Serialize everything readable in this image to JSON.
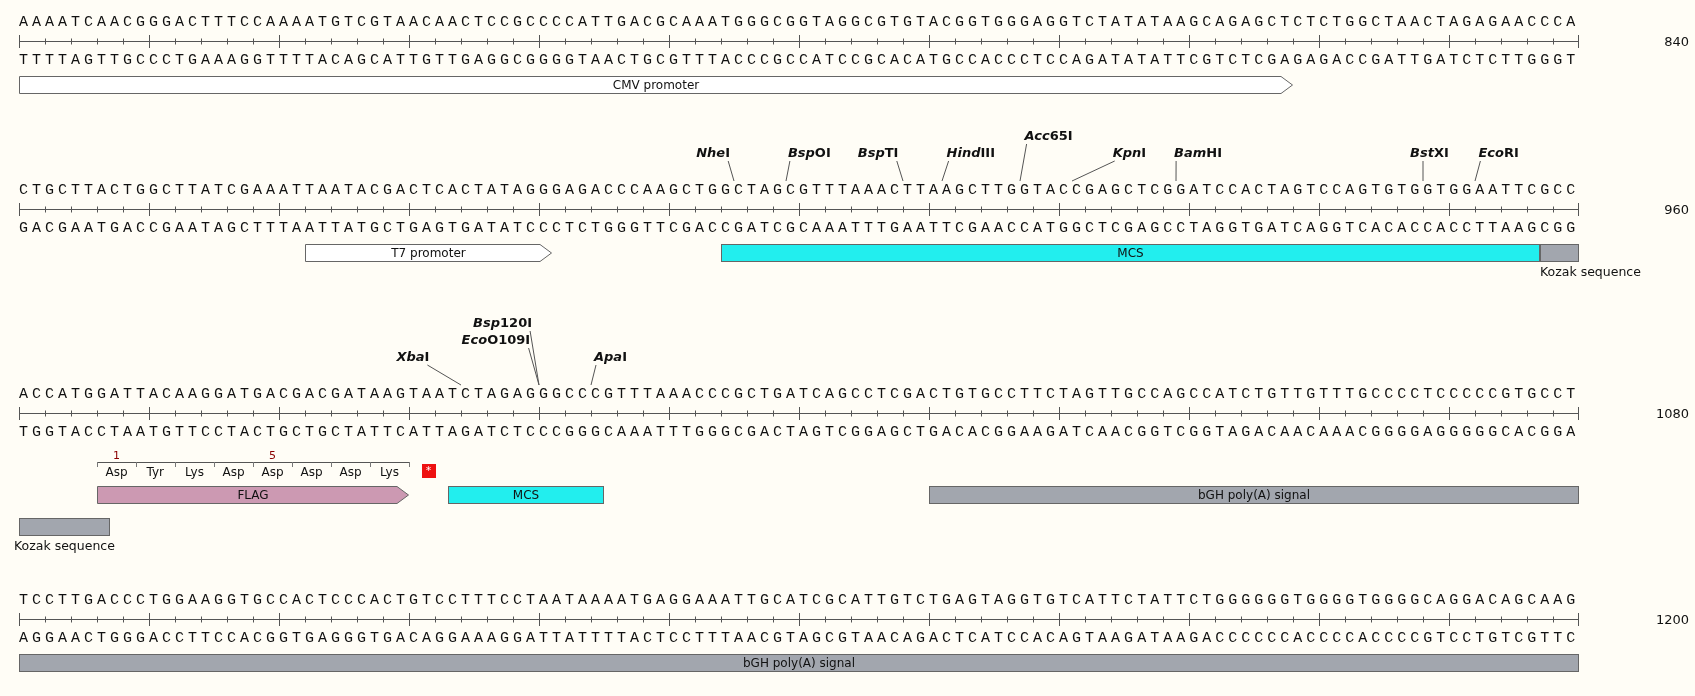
{
  "blocks": [
    {
      "end_number": "840",
      "top_strand": "AAAATCAACGGGACTTTCCAAAATGTCGTAACAACTCCGCCCCATTGACGCAAATGGGCGGTAGGCGTGTACGGTGGGAGGTCTATATAAGCAGAGCTCTCTGGCTAACTAGAGAACCCA",
      "bottom_strand": "TTTTAGTTGCCCTGAAAGGTTTTACAGCATTGTTGAGGCGGGGTAACTGCGTTTACCCGCCATCCGCACATGCCACCCTCCAGATATATTCGTCTCGAGAGACCGATTGATCTCTTGGGT",
      "feature_rows": [
        {
          "features": [
            {
              "label": "CMV promoter",
              "kind": "arrow",
              "color": "#ffffff",
              "label_below": false
            }
          ]
        }
      ]
    },
    {
      "end_number": "960",
      "top_strand": "CTGCTTACTGGCTTATCGAAATTAATACGACTCACTATAGGGAGACCCAAGCTGGCTAGCGTTTAAACTTAAGCTTGGTACCGAGCTCGGATCCACTAGTCCAGTGTGGTGGAATTCGCC",
      "bottom_strand": "GACGAATGACCGAATAGCTTTAATTATGCTGAGTGATATCCCTCTGGGTTCGACCGATCGCAAATTTGAATTCGAACCATGGCTCGAGCCTAGGTGATCAGGTCACACCACCTTAAGCGG",
      "enzymes": [
        {
          "name_italic": "Nhe",
          "name_rest": "I"
        },
        {
          "name_italic": "Bsp",
          "name_rest": "OI"
        },
        {
          "name_italic": "Bsp",
          "name_rest": "TI"
        },
        {
          "name_italic": "Hind",
          "name_rest": "III"
        },
        {
          "name_italic": "Acc",
          "name_rest": "65I"
        },
        {
          "name_italic": "Kpn",
          "name_rest": "I"
        },
        {
          "name_italic": "Bam",
          "name_rest": "HI"
        },
        {
          "name_italic": "Bst",
          "name_rest": "XI"
        },
        {
          "name_italic": "Eco",
          "name_rest": "RI"
        }
      ],
      "feature_rows": [
        {
          "features": [
            {
              "label": "T7 promoter",
              "kind": "arrow",
              "color": "#ffffff",
              "label_below": false
            },
            {
              "label": "MCS",
              "kind": "bar",
              "color": "#22eeee",
              "label_below": false
            },
            {
              "label": "Kozak sequence",
              "kind": "bar",
              "color": "#a2a6ae",
              "label_below": true
            }
          ]
        }
      ]
    },
    {
      "end_number": "1080",
      "top_strand": "ACCATGGATTACAAGGATGACGACGATAAGTAATCTAGAGGGCCCGTTTAAACCCGCTGATCAGCCTCGACTGTGCCTTCTAGTTGCCAGCCATCTGTTGTTTGCCCCTCCCCCGTGCCT",
      "bottom_strand": "TGGTACCTAATGTTCCTACTGCTGCTATTCATTAGATCTCCCGGGCAAATTTGGGCGACTAGTCGGAGCTGACACGGAAGATCAACGGTCGGTAGACAACAAACGGGGAGGGGGCACGGA",
      "enzymes": [
        {
          "name_italic": "Xba",
          "name_rest": "I"
        },
        {
          "name_italic": "Bsp",
          "name_rest": "120I"
        },
        {
          "name_italic": "Eco",
          "name_rest": "O109I"
        },
        {
          "name_italic": "Apa",
          "name_rest": "I"
        }
      ],
      "translation": {
        "residues": [
          {
            "name": "Asp",
            "number": "1"
          },
          {
            "name": "Tyr"
          },
          {
            "name": "Lys"
          },
          {
            "name": "Asp"
          },
          {
            "name": "Asp",
            "number": "5"
          },
          {
            "name": "Asp"
          },
          {
            "name": "Asp"
          },
          {
            "name": "Lys"
          }
        ],
        "stop": "*"
      },
      "feature_rows": [
        {
          "features": [
            {
              "label": "FLAG",
              "kind": "arrow",
              "color": "#cc99b2",
              "label_below": false
            },
            {
              "label": "MCS",
              "kind": "bar",
              "color": "#22eeee",
              "label_below": false
            },
            {
              "label": "bGH poly(A) signal",
              "kind": "bar",
              "color": "#a2a6ae",
              "label_below": false
            }
          ]
        },
        {
          "features": [
            {
              "label": "Kozak sequence",
              "kind": "bar",
              "color": "#a2a6ae",
              "label_below": true
            }
          ]
        }
      ]
    },
    {
      "end_number": "1200",
      "top_strand": "TCCTTGACCCTGGAAGGTGCCACTCCCACTGTCCTTTCCTAATAAAATGAGGAAATTGCATCGCATTGTCTGAGTAGGTGTCATTCTATTCTGGGGGGTGGGGTGGGGCAGGACAGCAAG",
      "bottom_strand": "AGGAACTGGGACCTTCCACGGTGAGGGTGACAGGAAAGGATTATTTTACTCCTTTAACGTAGCGTAACAGACTCATCCACAGTAAGATAAGACCCCCCACCCCACCCCGTCCTGTCGTTC",
      "feature_rows": [
        {
          "features": [
            {
              "label": "bGH poly(A) signal",
              "kind": "bar",
              "color": "#a2a6ae",
              "label_below": false
            }
          ]
        }
      ]
    }
  ]
}
